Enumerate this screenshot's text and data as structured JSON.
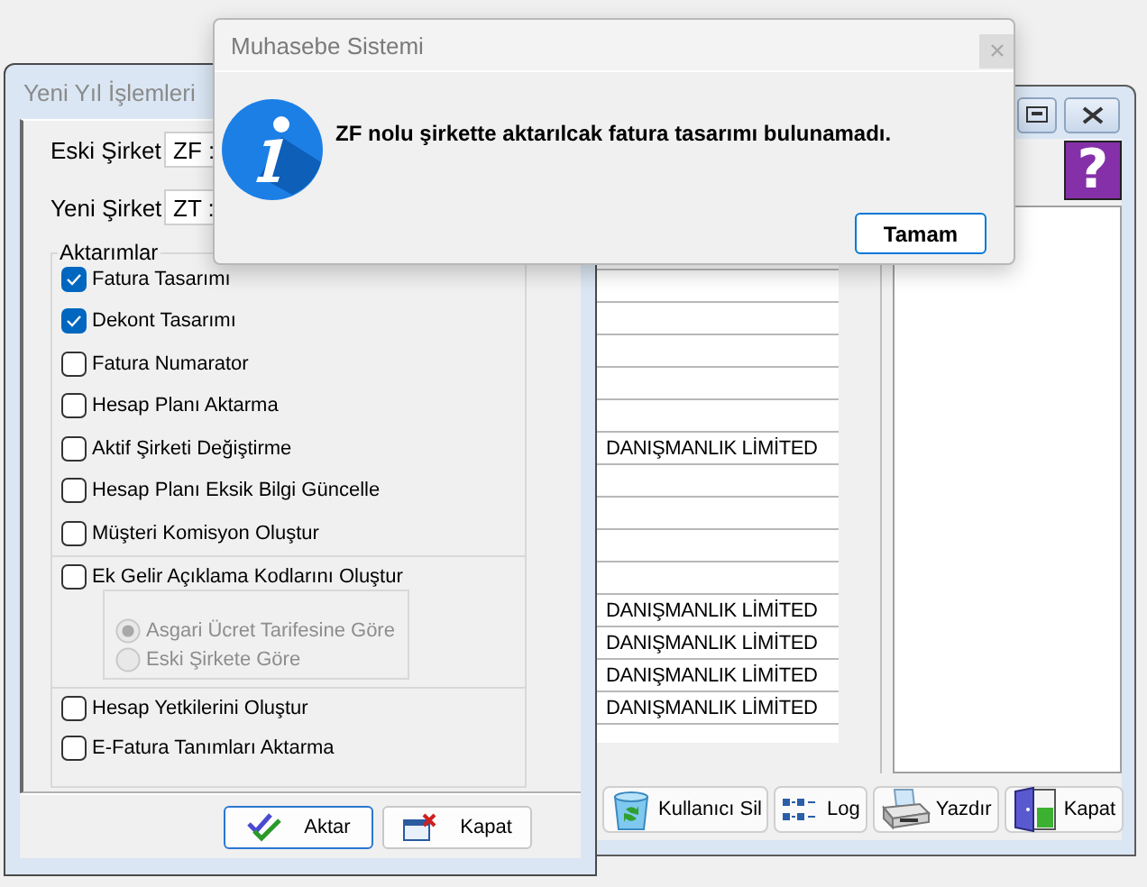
{
  "main_window": {
    "help_label": "?",
    "grid_rows": [
      {
        "kind": "empty"
      },
      {
        "kind": "empty"
      },
      {
        "kind": "empty"
      },
      {
        "kind": "empty"
      },
      {
        "kind": "empty"
      },
      {
        "kind": "empty"
      },
      {
        "kind": "empty"
      },
      {
        "kind": "text",
        "cell": "DANIŞMANLIK LİMİTED"
      },
      {
        "kind": "empty"
      },
      {
        "kind": "empty"
      },
      {
        "kind": "empty"
      },
      {
        "kind": "empty"
      },
      {
        "kind": "text",
        "cell": "DANIŞMANLIK LİMİTED"
      },
      {
        "kind": "text",
        "cell": "DANIŞMANLIK LİMİTED"
      },
      {
        "kind": "text",
        "cell": "DANIŞMANLIK LİMİTED"
      },
      {
        "kind": "text",
        "cell": "DANIŞMANLIK LİMİTED"
      }
    ],
    "toolbar": [
      {
        "label": "Kullanıcı Sil"
      },
      {
        "label": "Log"
      },
      {
        "label": "Yazdır"
      },
      {
        "label": "Kapat"
      }
    ]
  },
  "transfer_window": {
    "title": "Yeni Yıl İşlemleri",
    "fields": [
      {
        "label": "Eski Şirket",
        "value": "ZF :"
      },
      {
        "label": "Yeni Şirket",
        "value": "ZT :"
      }
    ],
    "group_title": "Aktarımlar",
    "sections": [
      {
        "items": [
          {
            "kind": "checkbox",
            "label": "Fatura Tasarımı",
            "checked": true
          },
          {
            "kind": "checkbox",
            "label": "Dekont Tasarımı",
            "checked": true
          },
          {
            "kind": "checkbox",
            "label": "Fatura Numarator",
            "checked": false
          },
          {
            "kind": "checkbox",
            "label": "Hesap Planı Aktarma",
            "checked": false
          },
          {
            "kind": "checkbox",
            "label": "Aktif Şirketi Değiştirme",
            "checked": false
          },
          {
            "kind": "checkbox",
            "label": "Hesap Planı Eksik Bilgi Güncelle",
            "checked": false
          },
          {
            "kind": "checkbox",
            "label": "Müşteri Komisyon Oluştur",
            "checked": false
          }
        ]
      },
      {
        "items": [
          {
            "kind": "checkbox",
            "label": "Ek Gelir Açıklama Kodlarını Oluştur",
            "checked": false
          },
          {
            "kind": "radio_group",
            "disabled": true,
            "radios": [
              {
                "label": "Asgari Ücret Tarifesine Göre",
                "selected": true
              },
              {
                "label": "Eski Şirkete Göre",
                "selected": false
              }
            ]
          }
        ]
      },
      {
        "items": [
          {
            "kind": "checkbox",
            "label": "Hesap Yetkilerini Oluştur",
            "checked": false
          },
          {
            "kind": "checkbox",
            "label": "E-Fatura Tanımları Aktarma",
            "checked": false
          }
        ]
      }
    ],
    "buttons": [
      {
        "label": "Aktar",
        "default": true
      },
      {
        "label": "Kapat",
        "default": false
      }
    ]
  },
  "dialog": {
    "title": "Muhasebe Sistemi",
    "message": "ZF nolu şirkette aktarılcak fatura tasarımı bulunamadı.",
    "button": "Tamam"
  }
}
